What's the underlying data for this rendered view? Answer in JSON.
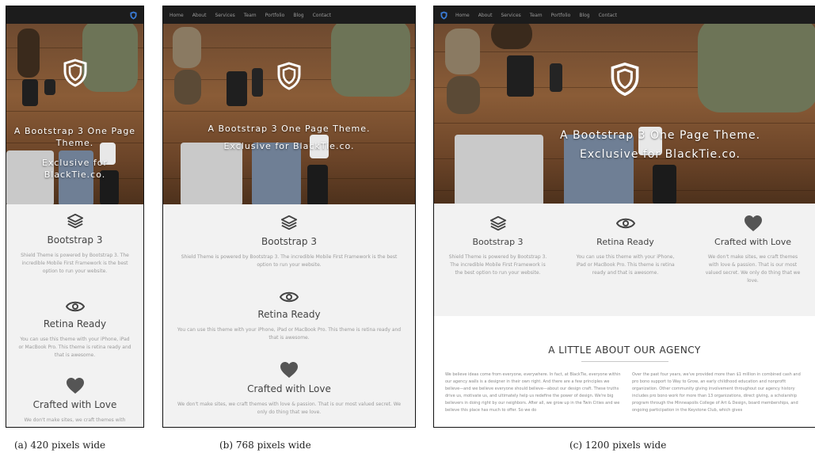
{
  "nav": {
    "items": [
      "Home",
      "About",
      "Services",
      "Team",
      "Portfolio",
      "Blog",
      "Contact"
    ]
  },
  "hero": {
    "line1_full": "A Bootstrap 3 One Page Theme.",
    "line2_full": "Exclusive for BlackTie.co.",
    "narrow_lines": [
      "A Bootstrap 3 One Page",
      "Theme.",
      "Exclusive for",
      "BlackTie.co."
    ]
  },
  "features": [
    {
      "icon": "layers-icon",
      "title": "Bootstrap 3",
      "text": "Shield Theme is powered by Bootstrap 3. The incredible Mobile First Framework is the best option to run your website."
    },
    {
      "icon": "eye-icon",
      "title": "Retina Ready",
      "text_full": "You can use this theme with your iPhone, iPad or MacBook Pro. This theme is retina ready and that is awesome.",
      "text_short": "You can use this theme with your iPhone, iPad or MacBook Pro. This theme is retina ready and that is awesome."
    },
    {
      "icon": "heart-icon",
      "title": "Crafted with Love",
      "text": "We don't make sites, we craft themes with love & passion. That is our most valued secret. We only do thing that we love.",
      "text_cut": "We don't make sites, we craft themes with"
    }
  ],
  "about": {
    "title": "A LITTLE ABOUT OUR AGENCY",
    "col1": "We believe ideas come from everyone, everywhere. In fact, at BlackTie, everyone within our agency walls is a designer in their own right. And there are a few principles we believe—and we believe everyone should believe—about our design craft. These truths drive us, motivate us, and ultimately help us redefine the power of design. We're big believers in doing right by our neighbors. After all, we grow up in the Twin Cities and we believe this place has much to offer. So we do",
    "col2": "Over the past four years, we've provided more than $1 million in combined cash and pro bono support to Way to Grow, an early childhood education and nonprofit organization. Other community giving involvement throughout our agency history includes pro bono work for more than 13 organizations, direct giving, a scholarship program through the Minneapolis College of Art & Design, board memberships, and ongoing participation in the Keystone Club, which gives"
  },
  "captions": {
    "a": "(a) 420 pixels wide",
    "b": "(b) 768 pixels wide",
    "c": "(c) 1200 pixels wide"
  },
  "colors": {
    "navbar": "#1c1c1c",
    "features_bg": "#f2f2f2",
    "shield_accent": "#3a7bd5"
  }
}
